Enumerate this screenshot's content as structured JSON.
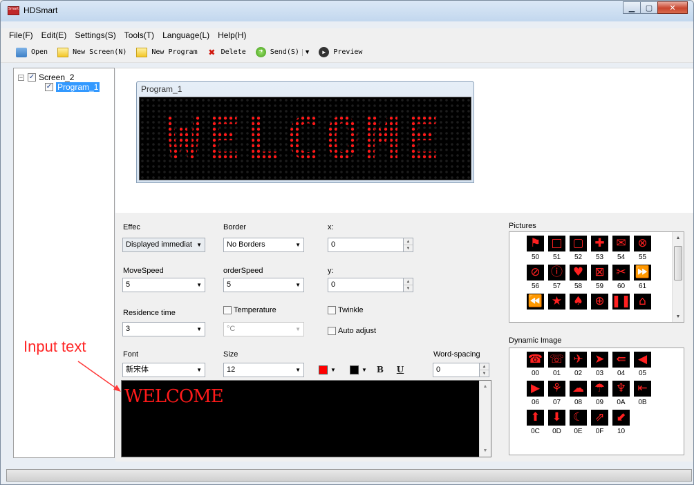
{
  "window": {
    "title": "HDSmart",
    "app_icon_text": "Smart"
  },
  "menu": [
    "File(F)",
    "Edit(E)",
    "Settings(S)",
    "Tools(T)",
    "Language(L)",
    "Help(H)"
  ],
  "toolbar": {
    "open": "Open",
    "new_screen": "New Screen(N)",
    "new_program": "New Program",
    "delete": "Delete",
    "send": "Send(S)",
    "preview": "Preview"
  },
  "tree": {
    "screen": "Screen_2",
    "program": "Program_1"
  },
  "preview": {
    "program_title": "Program_1",
    "led_text": "WELCOME",
    "led_color": "#ff1818"
  },
  "props": {
    "effect_label": "Effec",
    "effect_value": "Displayed immediat",
    "border_label": "Border",
    "border_value": "No Borders",
    "x_label": "x:",
    "x_value": "0",
    "movespeed_label": "MoveSpeed",
    "movespeed_value": "5",
    "orderspeed_label": "orderSpeed",
    "orderspeed_value": "5",
    "y_label": "y:",
    "y_value": "0",
    "residence_label": "Residence time",
    "residence_value": "3",
    "temperature_label": "Temperature",
    "temperature_unit": "°C",
    "twinkle_label": "Twinkle",
    "auto_adjust_label": "Auto adjust",
    "font_label": "Font",
    "font_value": "新宋体",
    "size_label": "Size",
    "size_value": "12",
    "text_color": "#ff0000",
    "bg_color": "#000000",
    "bold_label": "B",
    "underline_label": "U",
    "word_spacing_label": "Word-spacing",
    "word_spacing_value": "0"
  },
  "editor": {
    "text": "WELCOME",
    "text_color": "#ff1a1a"
  },
  "pictures": {
    "label": "Pictures",
    "items": [
      {
        "code": "50",
        "glyph": "⚑"
      },
      {
        "code": "51",
        "glyph": "□"
      },
      {
        "code": "52",
        "glyph": "▢"
      },
      {
        "code": "53",
        "glyph": "✚"
      },
      {
        "code": "54",
        "glyph": "✉"
      },
      {
        "code": "55",
        "glyph": "⊗"
      },
      {
        "code": "56",
        "glyph": "⊘"
      },
      {
        "code": "57",
        "glyph": "ⓘ"
      },
      {
        "code": "58",
        "glyph": "♥"
      },
      {
        "code": "59",
        "glyph": "⊠"
      },
      {
        "code": "60",
        "glyph": "✂"
      },
      {
        "code": "61",
        "glyph": "⏩"
      },
      {
        "code": "",
        "glyph": "⏪"
      },
      {
        "code": "",
        "glyph": "★"
      },
      {
        "code": "",
        "glyph": "♠"
      },
      {
        "code": "",
        "glyph": "⊕"
      },
      {
        "code": "",
        "glyph": "❚❚"
      },
      {
        "code": "",
        "glyph": "⌂"
      }
    ]
  },
  "dynamic": {
    "label": "Dynamic Image",
    "items": [
      {
        "code": "00",
        "glyph": "☎"
      },
      {
        "code": "01",
        "glyph": "☏"
      },
      {
        "code": "02",
        "glyph": "✈"
      },
      {
        "code": "03",
        "glyph": "➤"
      },
      {
        "code": "04",
        "glyph": "⇚"
      },
      {
        "code": "05",
        "glyph": "◀"
      },
      {
        "code": "06",
        "glyph": "▶"
      },
      {
        "code": "07",
        "glyph": "⚘"
      },
      {
        "code": "08",
        "glyph": "☁"
      },
      {
        "code": "09",
        "glyph": "☂"
      },
      {
        "code": "0A",
        "glyph": "♆"
      },
      {
        "code": "0B",
        "glyph": "⇤"
      },
      {
        "code": "0C",
        "glyph": "⬆"
      },
      {
        "code": "0D",
        "glyph": "⬇"
      },
      {
        "code": "0E",
        "glyph": "☾"
      },
      {
        "code": "0F",
        "glyph": "⇗"
      },
      {
        "code": "10",
        "glyph": "⬋"
      }
    ]
  },
  "annotation": {
    "text": "Input text",
    "color": "#ff2424"
  }
}
